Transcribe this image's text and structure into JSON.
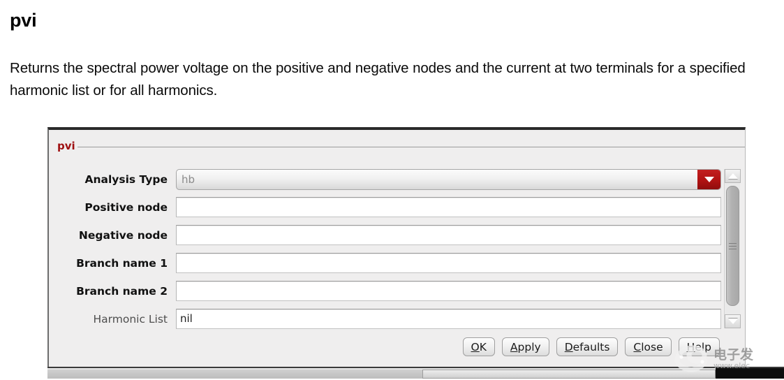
{
  "doc": {
    "title": "pvi",
    "description": "Returns the spectral power voltage on the positive and negative nodes and the current at two terminals for a specified harmonic list or for all harmonics."
  },
  "dialog": {
    "group_title": "pvi",
    "accent_color": "#9e0f11",
    "fields": [
      {
        "label": "Analysis Type",
        "type": "combobox",
        "value": "hb",
        "label_style": "bold",
        "arrow_icon": "chevron-down-icon",
        "arrow_color": "#b01212"
      },
      {
        "label": "Positive node",
        "type": "text",
        "value": "",
        "label_style": "bold"
      },
      {
        "label": "Negative node",
        "type": "text",
        "value": "",
        "label_style": "bold"
      },
      {
        "label": "Branch name 1",
        "type": "text",
        "value": "",
        "label_style": "bold"
      },
      {
        "label": "Branch name 2",
        "type": "text",
        "value": "",
        "label_style": "bold"
      },
      {
        "label": "Harmonic List",
        "type": "text",
        "value": "nil",
        "label_style": "regular"
      }
    ],
    "scrollbar": {
      "up_icon": "triangle-up-icon",
      "down_icon": "triangle-down-icon",
      "thumb_icon": "grip-lines-icon"
    },
    "buttons": [
      {
        "label": "OK",
        "mnemonic": "O"
      },
      {
        "label": "Apply",
        "mnemonic": "A"
      },
      {
        "label": "Defaults",
        "mnemonic": "D"
      },
      {
        "label": "Close",
        "mnemonic": "C"
      },
      {
        "label": "Help",
        "mnemonic": "H"
      }
    ]
  },
  "watermark": {
    "cn_text": "电子发",
    "url_text": "www.elec"
  }
}
